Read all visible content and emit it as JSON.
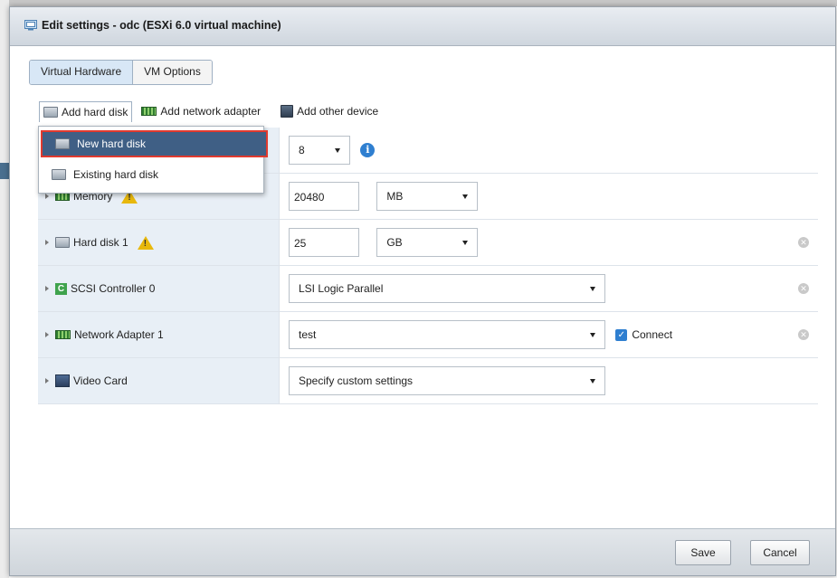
{
  "dialog": {
    "title": "Edit settings - odc (ESXi 6.0 virtual machine)"
  },
  "tabs": [
    {
      "label": "Virtual Hardware",
      "active": true
    },
    {
      "label": "VM Options",
      "active": false
    }
  ],
  "toolbar": {
    "add_hard_disk": "Add hard disk",
    "add_network_adapter": "Add network adapter",
    "add_other_device": "Add other device"
  },
  "dropdown_menu": {
    "items": [
      {
        "label": "New hard disk",
        "highlighted": true
      },
      {
        "label": "Existing hard disk",
        "highlighted": false
      }
    ]
  },
  "hardware": {
    "cpu": {
      "value": "8"
    },
    "memory": {
      "label": "Memory",
      "value": "20480",
      "unit": "MB"
    },
    "hard_disk_1": {
      "label": "Hard disk 1",
      "value": "25",
      "unit": "GB"
    },
    "scsi_controller_0": {
      "label": "SCSI Controller 0",
      "value": "LSI Logic Parallel"
    },
    "network_adapter_1": {
      "label": "Network Adapter 1",
      "value": "test",
      "connect_label": "Connect",
      "connected": true
    },
    "video_card": {
      "label": "Video Card",
      "value": "Specify custom settings"
    }
  },
  "footer": {
    "save": "Save",
    "cancel": "Cancel"
  },
  "colors": {
    "menu_highlight": "#3f5f85",
    "selection_outline": "#e03a2f",
    "row_label_bg": "#e8eff6",
    "active_tab_bg": "#d8e7f6",
    "warning": "#e8b80c",
    "info": "#2f7fd0"
  }
}
